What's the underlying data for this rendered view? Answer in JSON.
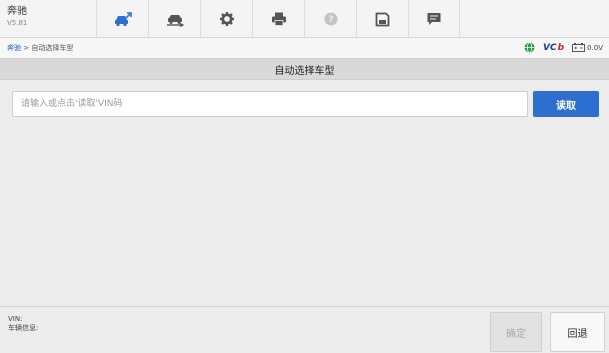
{
  "app": {
    "name": "奔驰",
    "version": "V5.81"
  },
  "toolbar": {
    "items": [
      {
        "name": "home-car-icon",
        "color": "#2c6fcf"
      },
      {
        "name": "vehicle-swap-icon",
        "color": "#555555"
      },
      {
        "name": "gear-icon",
        "color": "#555555"
      },
      {
        "name": "printer-icon",
        "color": "#555555"
      },
      {
        "name": "help-icon",
        "color": "#bbbbbb"
      },
      {
        "name": "save-icon",
        "color": "#555555"
      },
      {
        "name": "message-icon",
        "color": "#555555"
      }
    ]
  },
  "breadcrumb": {
    "link": "奔驰",
    "separator": " > ",
    "current": "自动选择车型"
  },
  "status": {
    "vci_label_v": "VC",
    "vci_label_b": "b",
    "voltage": "0.0V"
  },
  "page": {
    "title": "自动选择车型"
  },
  "vin": {
    "placeholder": "请输入或点击'读取'VIN码",
    "value": ""
  },
  "buttons": {
    "read": "读取",
    "confirm": "确定",
    "back": "回退"
  },
  "info": {
    "vin_label": "VIN:",
    "vehicle_info_label": "车辆信息:"
  },
  "colors": {
    "accent": "#2c6fcf",
    "toolbar_bg": "#f4f4f4",
    "title_bg": "#d9d9d9",
    "content_bg": "#ececec"
  }
}
